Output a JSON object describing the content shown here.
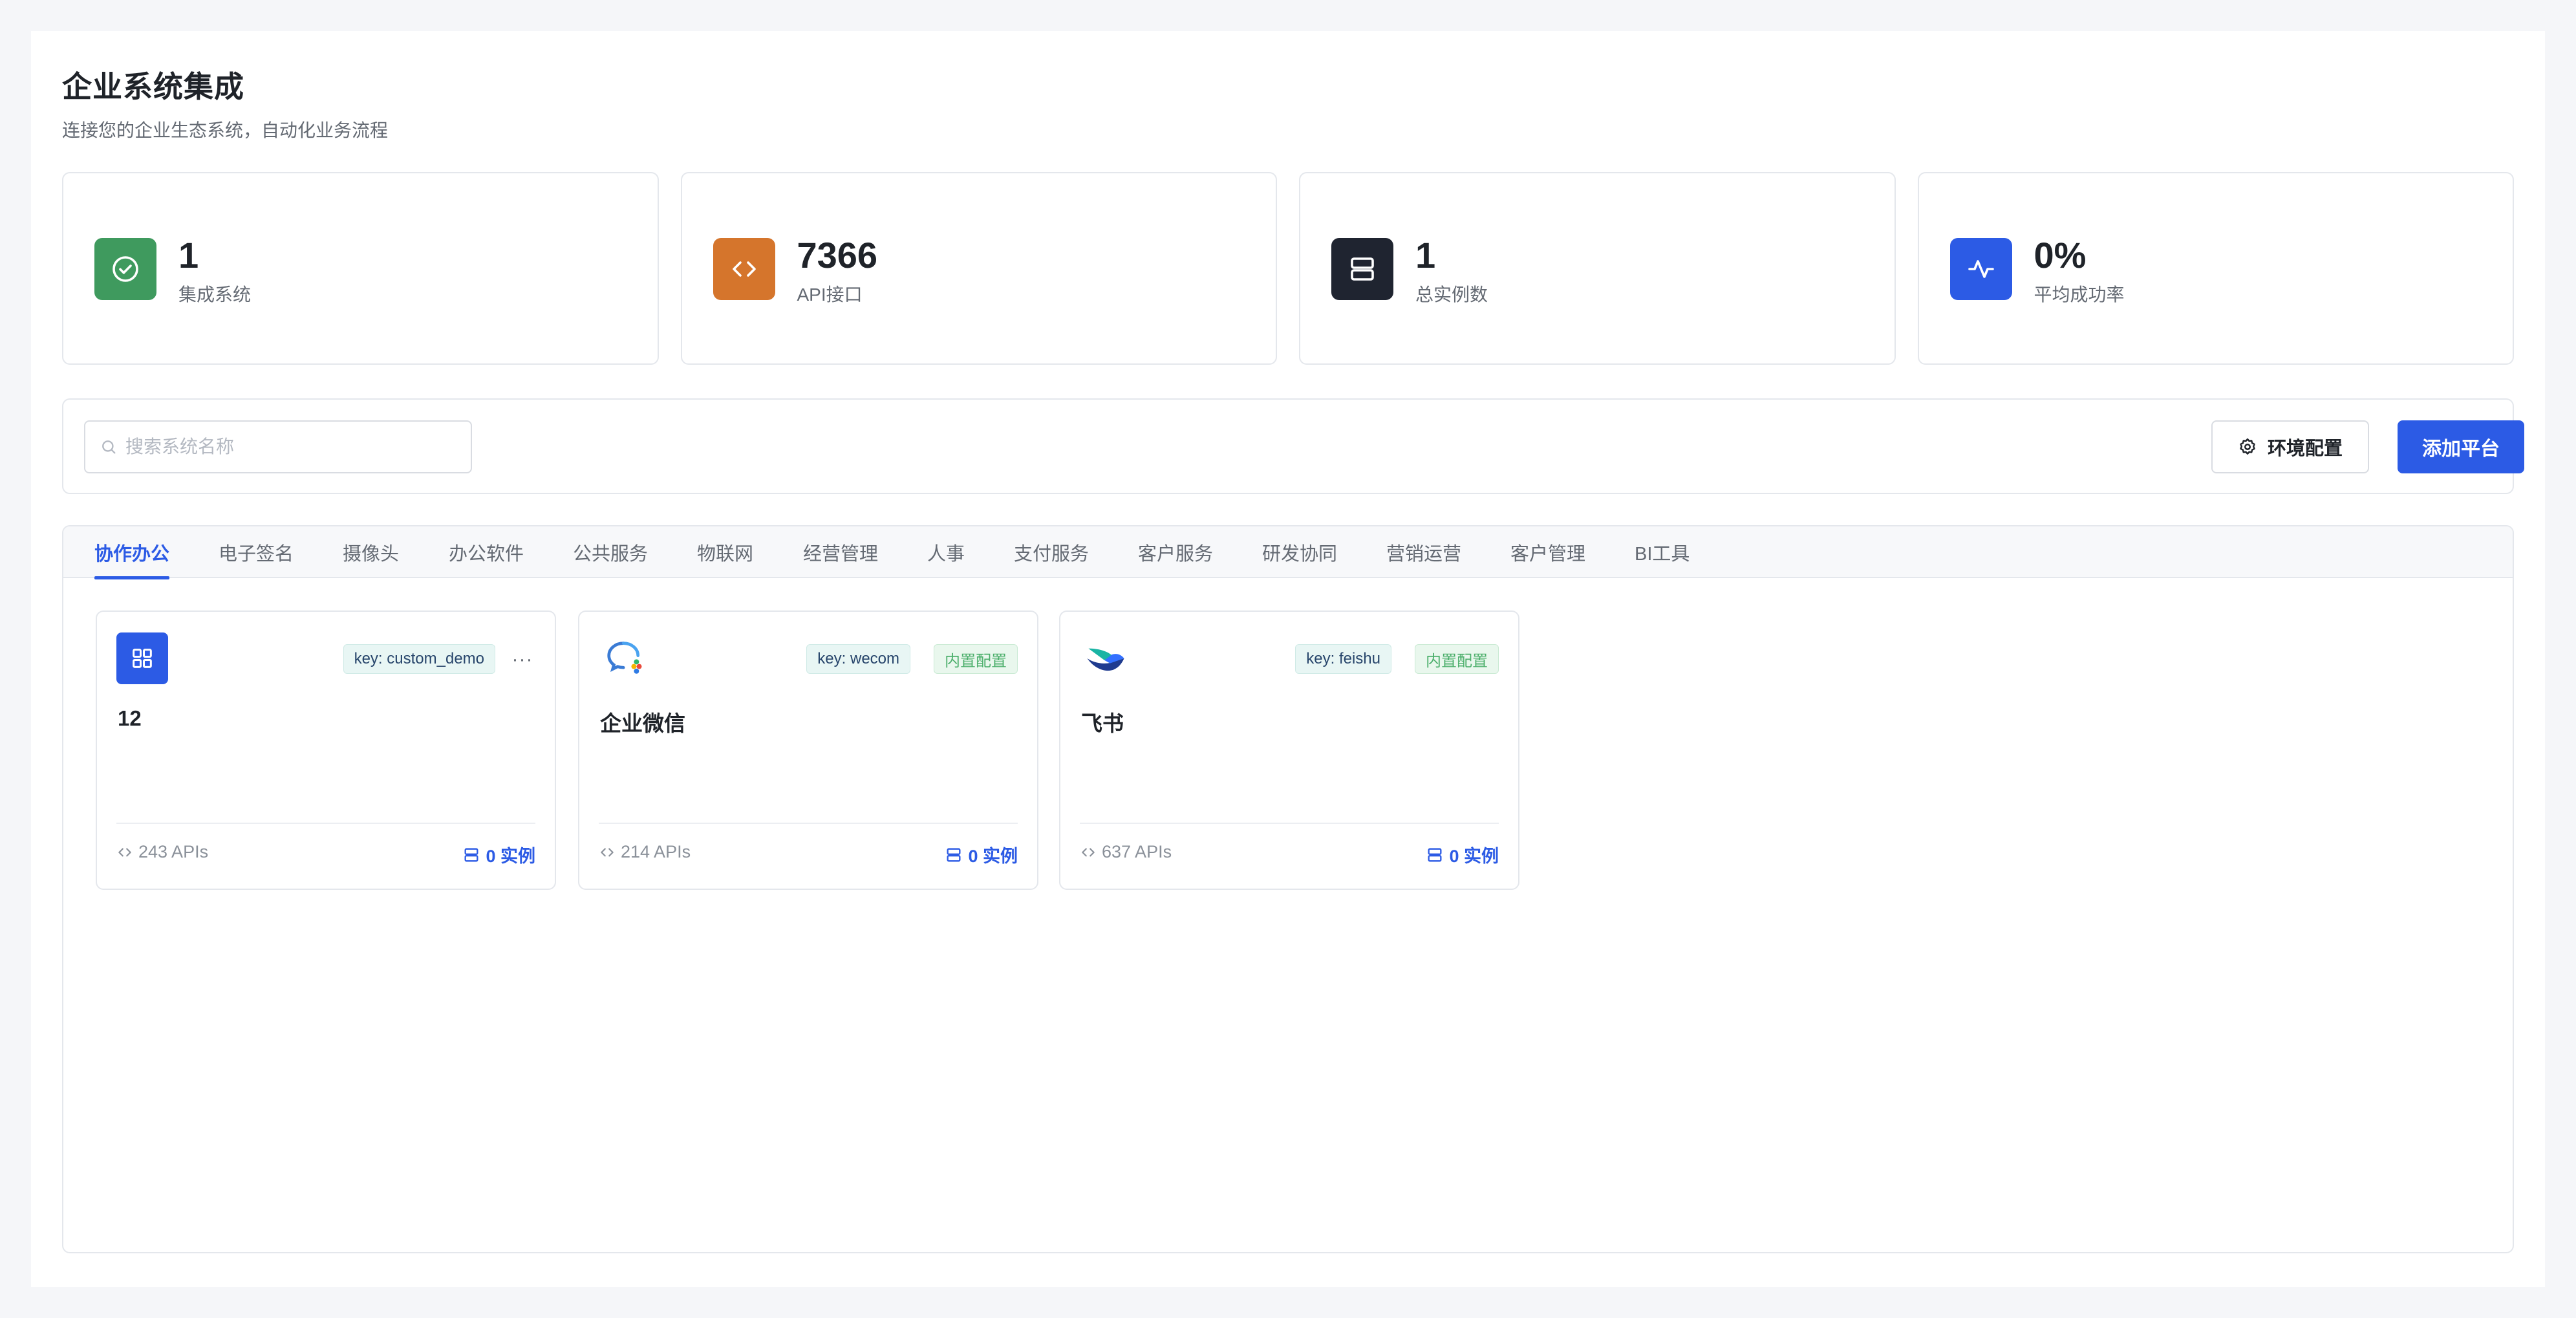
{
  "header": {
    "title": "企业系统集成",
    "subtitle": "连接您的企业生态系统，自动化业务流程"
  },
  "stats": [
    {
      "value": "1",
      "label": "集成系统",
      "icon": "check-circle-icon",
      "color": "#3f9a5e"
    },
    {
      "value": "7366",
      "label": "API接口",
      "icon": "code-icon",
      "color": "#d5752c"
    },
    {
      "value": "1",
      "label": "总实例数",
      "icon": "server-icon",
      "color": "#1f2430"
    },
    {
      "value": "0%",
      "label": "平均成功率",
      "icon": "activity-icon",
      "color": "#2c5be5"
    }
  ],
  "toolbar": {
    "search_placeholder": "搜索系统名称",
    "env_label": "环境配置",
    "add_label": "添加平台"
  },
  "tabs": [
    {
      "label": "协作办公",
      "active": true
    },
    {
      "label": "电子签名"
    },
    {
      "label": "摄像头"
    },
    {
      "label": "办公软件"
    },
    {
      "label": "公共服务"
    },
    {
      "label": "物联网"
    },
    {
      "label": "经营管理"
    },
    {
      "label": "人事"
    },
    {
      "label": "支付服务"
    },
    {
      "label": "客户服务"
    },
    {
      "label": "研发协同"
    },
    {
      "label": "营销运营"
    },
    {
      "label": "客户管理"
    },
    {
      "label": "BI工具"
    }
  ],
  "systems": [
    {
      "name": "12",
      "key": "key: custom_demo",
      "builtin": "",
      "apis": "243 APIs",
      "instances": "0 实例",
      "logo": "grid-icon"
    },
    {
      "name": "企业微信",
      "key": "key: wecom",
      "builtin": "内置配置",
      "apis": "214 APIs",
      "instances": "0 实例",
      "logo": "wecom-logo-icon"
    },
    {
      "name": "飞书",
      "key": "key: feishu",
      "builtin": "内置配置",
      "apis": "637 APIs",
      "instances": "0 实例",
      "logo": "feishu-logo-icon"
    }
  ]
}
